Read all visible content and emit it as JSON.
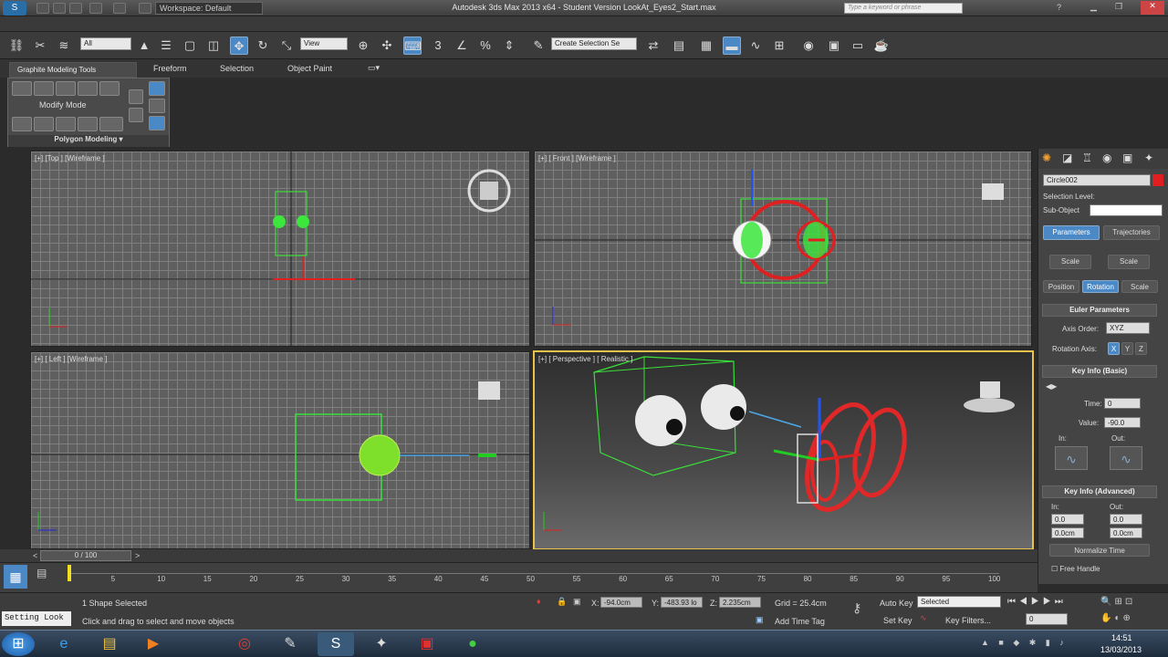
{
  "window": {
    "title": "Autodesk 3ds Max 2013 x64  - Student Version   LookAt_Eyes2_Start.max",
    "workspace": "Workspace: Default",
    "search_placeholder": "Type a keyword or phrase"
  },
  "toolbar": {
    "filter": "All",
    "ref_coord": "View",
    "selection_set": "Create Selection Se"
  },
  "ribbon": {
    "tabs": [
      "Graphite Modeling Tools",
      "Freeform",
      "Selection",
      "Object Paint"
    ],
    "modify_mode": "Modify Mode",
    "polygon_modeling": "Polygon Modeling"
  },
  "viewports": {
    "top": "[+] [Top ] [Wireframe ]",
    "front": "[+] [ Front ] [Wireframe ]",
    "left": "[+] [ Left ] [Wireframe ]",
    "perspective": "[+] [ Perspective ] [ Realistic ]"
  },
  "command_panel": {
    "object_name": "Circle002",
    "object_color": "#e02020",
    "selection_level": "Selection Level:",
    "sub_object": "Sub-Object",
    "tabs": [
      "Parameters",
      "Trajectories"
    ],
    "scale_buttons": [
      "Scale",
      "Scale"
    ],
    "prs_buttons": [
      "Position",
      "Rotation",
      "Scale"
    ],
    "euler_header": "Euler Parameters",
    "axis_order_label": "Axis Order:",
    "axis_order": "XYZ",
    "rotation_axis_label": "Rotation Axis:",
    "rotation_axes": [
      "X",
      "Y",
      "Z"
    ],
    "key_info_basic": "Key Info (Basic)",
    "time_label": "Time:",
    "time_value": "0",
    "value_label": "Value:",
    "value": "-90.0",
    "in_label": "In:",
    "out_label": "Out:",
    "key_info_advanced": "Key Info (Advanced)",
    "adv_in_label": "In:",
    "adv_out_label": "Out:",
    "adv_in1": "0.0",
    "adv_out1": "0.0",
    "adv_in2": "0.0cm",
    "adv_out2": "0.0cm",
    "normalize_time": "Normalize Time",
    "free_handle": "Free Handle"
  },
  "timeline": {
    "frame": "0 / 100",
    "ticks": [
      "5",
      "10",
      "15",
      "20",
      "25",
      "30",
      "35",
      "40",
      "45",
      "50",
      "55",
      "60",
      "65",
      "70",
      "75",
      "80",
      "85",
      "90",
      "95",
      "100"
    ],
    "progress": 0
  },
  "status": {
    "listener": "Setting Look",
    "selected": "1 Shape Selected",
    "prompt": "Click and drag to select and move objects",
    "x_label": "X:",
    "x": "-94.0cm",
    "y_label": "Y:",
    "y": "-483.93 lo",
    "z_label": "Z:",
    "z": "2.235cm",
    "grid": "Grid = 25.4cm",
    "add_time_tag": "Add Time Tag",
    "auto_key": "Auto Key",
    "set_key": "Set Key",
    "key_mode": "Selected",
    "key_filters": "Key Filters...",
    "current_frame": "0"
  },
  "taskbar": {
    "time": "14:51",
    "date": "13/03/2013"
  }
}
